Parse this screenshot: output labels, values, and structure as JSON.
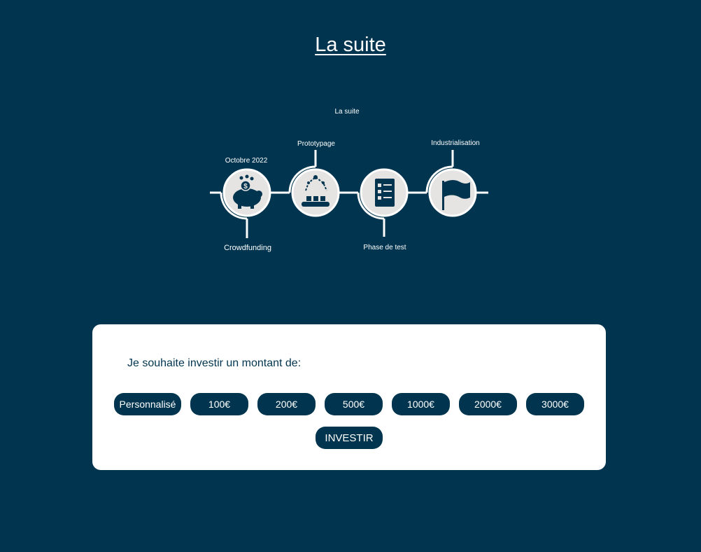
{
  "page": {
    "title": "La suite"
  },
  "roadmap": {
    "title": "La suite",
    "steps": [
      {
        "label": "Crowdfunding",
        "date": "Octobre 2022",
        "icon": "piggy-bank-icon"
      },
      {
        "label": "Prototypage",
        "icon": "robot-arm-icon"
      },
      {
        "label": "Phase de test",
        "icon": "checklist-icon"
      },
      {
        "label": "Industrialisation",
        "icon": "flag-icon"
      }
    ]
  },
  "invest": {
    "prompt": "Je souhaite investir un montant de:",
    "amounts": [
      "Personnalisé",
      "100€",
      "200€",
      "500€",
      "1000€",
      "2000€",
      "3000€"
    ],
    "submit_label": "INVESTIR"
  },
  "colors": {
    "background": "#01354f",
    "card": "#ffffff",
    "button": "#01354f",
    "icon_circle": "#e6e3e3"
  }
}
